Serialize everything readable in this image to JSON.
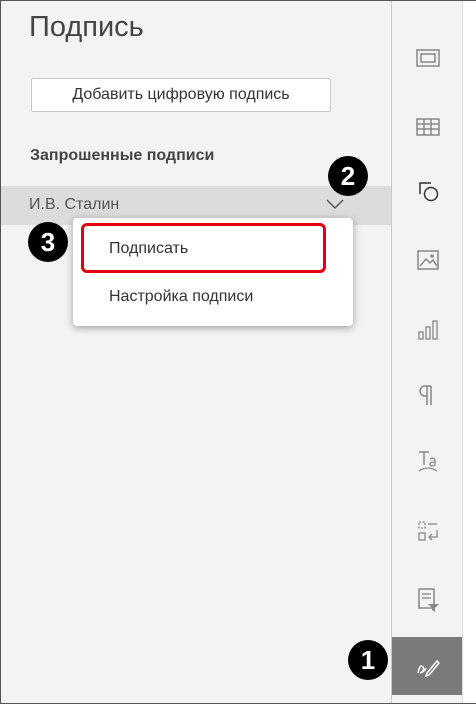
{
  "panel": {
    "title": "Подпись",
    "add_button_label": "Добавить цифровую подпись",
    "requested_label": "Запрошенные подписи",
    "signer_name": "И.В. Сталин"
  },
  "menu": {
    "items": [
      {
        "label": "Подписать"
      },
      {
        "label": "Настройка подписи"
      }
    ]
  },
  "badges": [
    "1",
    "2",
    "3"
  ],
  "sidebar": {
    "icons": [
      "slide-settings-icon",
      "table-icon",
      "shape-icon",
      "image-icon",
      "chart-icon",
      "paragraph-icon",
      "text-art-icon",
      "form-icon",
      "mail-merge-icon",
      "signature-icon"
    ],
    "active": "signature-icon"
  },
  "colors": {
    "highlight": "#e0000f",
    "row_selected": "#dcdcdc",
    "active_tab": "#7a7a7a",
    "badge": "#000000"
  }
}
